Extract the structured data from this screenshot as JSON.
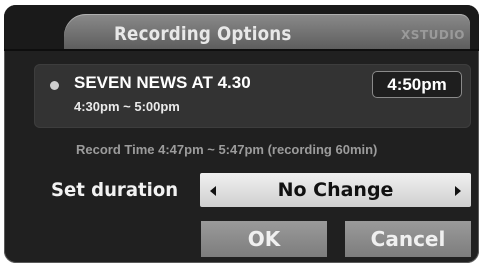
{
  "dialog": {
    "title": "Recording Options",
    "brand": "XSTUDIO"
  },
  "program": {
    "title": "SEVEN NEWS AT 4.30",
    "time_range": "4:30pm ~ 5:00pm",
    "start_badge": "4:50pm"
  },
  "record": {
    "info": "Record Time 4:47pm ~ 5:47pm (recording 60min)"
  },
  "duration": {
    "label": "Set duration",
    "value": "No Change"
  },
  "buttons": {
    "ok": "OK",
    "cancel": "Cancel"
  }
}
